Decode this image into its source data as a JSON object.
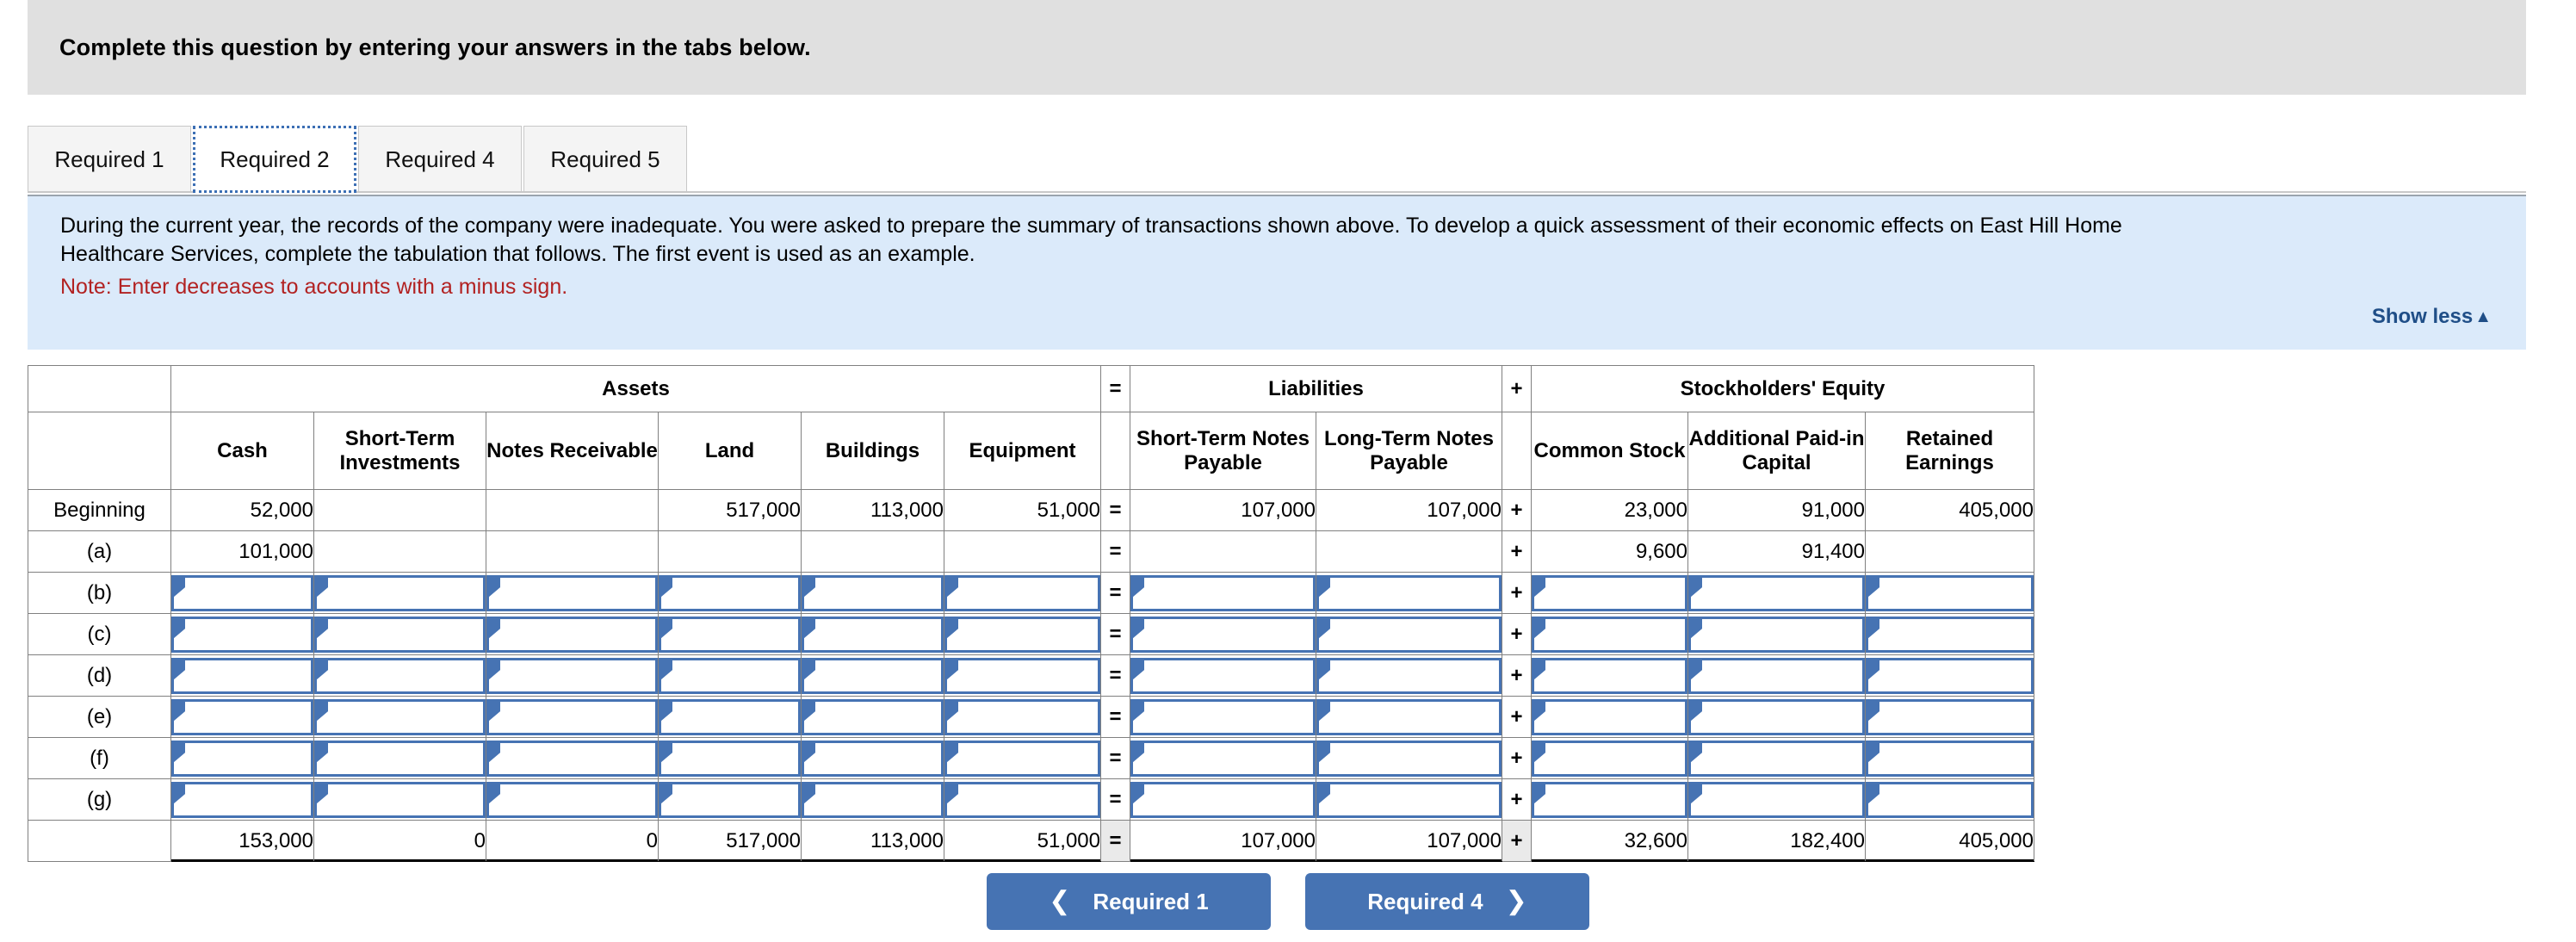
{
  "banner": {
    "title": "Complete this question by entering your answers in the tabs below."
  },
  "tabs": {
    "items": [
      {
        "label": "Required 1",
        "active": false
      },
      {
        "label": "Required 2",
        "active": true
      },
      {
        "label": "Required 4",
        "active": false
      },
      {
        "label": "Required 5",
        "active": false
      }
    ]
  },
  "instructions": {
    "line1": "During the current year, the records of the company were inadequate. You were asked to prepare the summary of transactions shown above. To develop a quick assessment of their economic effects on East Hill Home",
    "line2": "Healthcare Services, complete the tabulation that follows. The first event is used as an example.",
    "note": "Note: Enter decreases to accounts with a minus sign.",
    "show_less_label": "Show less",
    "show_less_icon": "caret-up-icon"
  },
  "worksheet": {
    "group_headers": {
      "corner": "",
      "assets": "Assets",
      "equals": "=",
      "liabilities": "Liabilities",
      "plus": "+",
      "equity": "Stockholders' Equity"
    },
    "column_headers": {
      "label": "",
      "cash": "Cash",
      "short_term_investments": "Short-Term Investments",
      "notes_receivable": "Notes Receivable",
      "land": "Land",
      "buildings": "Buildings",
      "equipment": "Equipment",
      "equals": "",
      "short_term_notes_payable": "Short-Term Notes Payable",
      "long_term_notes_payable": "Long-Term Notes Payable",
      "plus": "",
      "common_stock": "Common Stock",
      "additional_paid_in_capital": "Additional Paid-in Capital",
      "retained_earnings": "Retained Earnings"
    },
    "operators": {
      "equals": "=",
      "plus": "+"
    },
    "rows": [
      {
        "label": "Beginning",
        "editable": false,
        "cells": [
          "52,000",
          "",
          "",
          "517,000",
          "113,000",
          "51,000",
          "107,000",
          "107,000",
          "23,000",
          "91,000",
          "405,000"
        ]
      },
      {
        "label": "(a)",
        "editable": false,
        "cells": [
          "101,000",
          "",
          "",
          "",
          "",
          "",
          "",
          "",
          "9,600",
          "91,400",
          ""
        ]
      },
      {
        "label": "(b)",
        "editable": true,
        "cells": [
          "",
          "",
          "",
          "",
          "",
          "",
          "",
          "",
          "",
          "",
          ""
        ]
      },
      {
        "label": "(c)",
        "editable": true,
        "cells": [
          "",
          "",
          "",
          "",
          "",
          "",
          "",
          "",
          "",
          "",
          ""
        ]
      },
      {
        "label": "(d)",
        "editable": true,
        "cells": [
          "",
          "",
          "",
          "",
          "",
          "",
          "",
          "",
          "",
          "",
          ""
        ]
      },
      {
        "label": "(e)",
        "editable": true,
        "cells": [
          "",
          "",
          "",
          "",
          "",
          "",
          "",
          "",
          "",
          "",
          ""
        ]
      },
      {
        "label": "(f)",
        "editable": true,
        "cells": [
          "",
          "",
          "",
          "",
          "",
          "",
          "",
          "",
          "",
          "",
          ""
        ]
      },
      {
        "label": "(g)",
        "editable": true,
        "cells": [
          "",
          "",
          "",
          "",
          "",
          "",
          "",
          "",
          "",
          "",
          ""
        ]
      }
    ],
    "totals": {
      "label": "",
      "cells": [
        "153,000",
        "0",
        "0",
        "517,000",
        "113,000",
        "51,000",
        "107,000",
        "107,000",
        "32,600",
        "182,400",
        "405,000"
      ]
    }
  },
  "navigation": {
    "prev_label": "Required 1",
    "prev_icon": "chevron-left-icon",
    "next_label": "Required 4",
    "next_icon": "chevron-right-icon"
  },
  "colors": {
    "header_blue": "#8cb1e0",
    "panel_blue": "#dbeafa",
    "banner_grey": "#e0e0e0",
    "accent_blue": "#4673b3",
    "note_red": "#b22222",
    "link_blue": "#1f4e87"
  }
}
